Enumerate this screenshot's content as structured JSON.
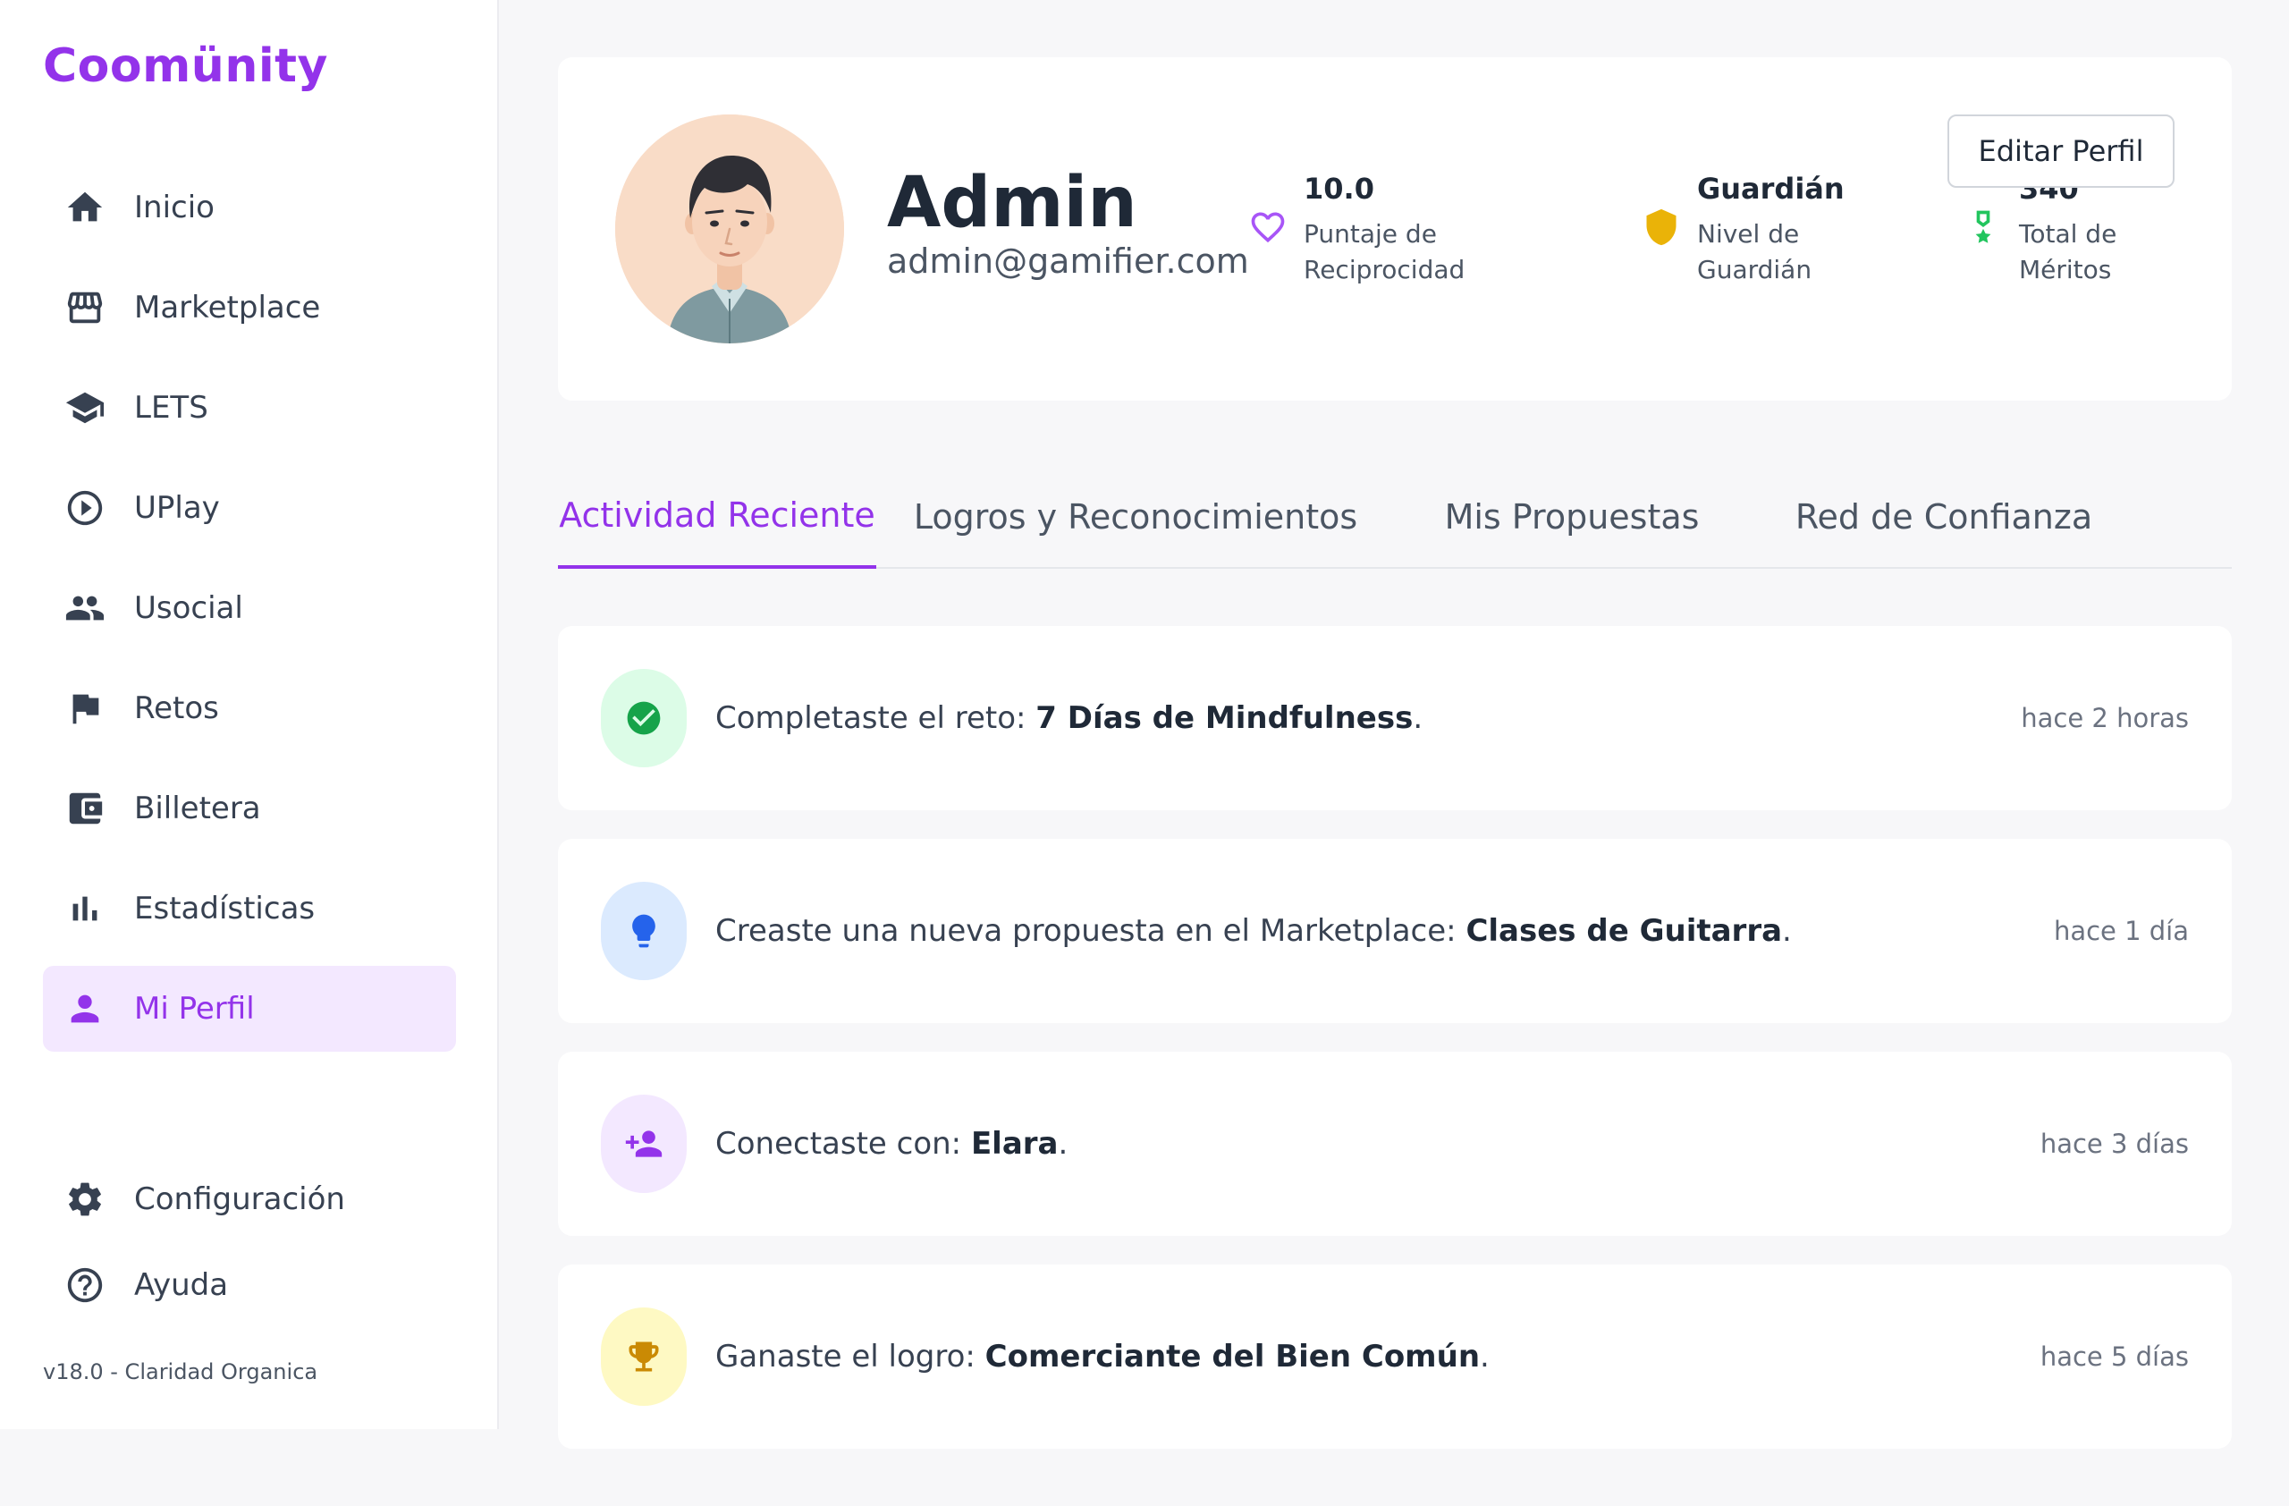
{
  "brand": "Coomünity",
  "nav": {
    "items": [
      {
        "label": "Inicio",
        "icon": "home-icon"
      },
      {
        "label": "Marketplace",
        "icon": "store-icon"
      },
      {
        "label": "LETS",
        "icon": "school-icon"
      },
      {
        "label": "UPlay",
        "icon": "play-circle-icon"
      },
      {
        "label": "Usocial",
        "icon": "people-icon"
      },
      {
        "label": "Retos",
        "icon": "flag-icon"
      },
      {
        "label": "Billetera",
        "icon": "wallet-icon"
      },
      {
        "label": "Estadísticas",
        "icon": "bar-chart-icon"
      },
      {
        "label": "Mi Perfil",
        "icon": "person-icon",
        "active": true
      }
    ],
    "bottom": [
      {
        "label": "Configuración",
        "icon": "gear-icon"
      },
      {
        "label": "Ayuda",
        "icon": "help-icon"
      }
    ]
  },
  "version": "v18.0 - Claridad Organica",
  "profile": {
    "name": "Admin",
    "email": "admin@gamifier.com",
    "edit_label": "Editar Perfil",
    "stats": [
      {
        "value": "10.0",
        "label": "Puntaje de Reciprocidad",
        "icon": "heart-icon",
        "color": "#a855f7"
      },
      {
        "value": "Guardián",
        "label": "Nivel de Guardián",
        "icon": "shield-icon",
        "color": "#eab308"
      },
      {
        "value": "340",
        "label": "Total de Méritos",
        "icon": "medal-icon",
        "color": "#22c55e"
      }
    ]
  },
  "tabs": [
    {
      "label": "Actividad Reciente",
      "active": true
    },
    {
      "label": "Logros y Reconocimientos"
    },
    {
      "label": "Mis Propuestas"
    },
    {
      "label": "Red de Confianza"
    }
  ],
  "activities": [
    {
      "prefix": "Completaste el reto: ",
      "bold": "7 Días de Mindfulness",
      "suffix": ".",
      "time": "hace 2 horas",
      "icon": "check-circle-icon",
      "bg": "#dcfce7",
      "color": "#16a34a"
    },
    {
      "prefix": "Creaste una nueva propuesta en el Marketplace: ",
      "bold": "Clases de Guitarra",
      "suffix": ".",
      "time": "hace 1 día",
      "icon": "lightbulb-icon",
      "bg": "#dbeafe",
      "color": "#2563eb"
    },
    {
      "prefix": "Conectaste con: ",
      "bold": "Elara",
      "suffix": ".",
      "time": "hace 3 días",
      "icon": "person-add-icon",
      "bg": "#f3e8ff",
      "color": "#9333ea"
    },
    {
      "prefix": "Ganaste el logro: ",
      "bold": "Comerciante del Bien Común",
      "suffix": ".",
      "time": "hace 5 días",
      "icon": "trophy-icon",
      "bg": "#fef9c3",
      "color": "#ca8a04"
    }
  ],
  "colors": {
    "accent": "#9333ea",
    "accent_bg": "#f3e8ff"
  }
}
